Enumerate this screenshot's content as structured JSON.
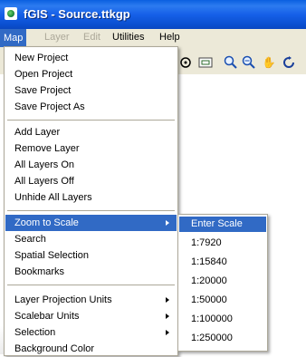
{
  "window": {
    "title": "fGIS - Source.ttkgp"
  },
  "menubar": {
    "items": [
      {
        "label": "Map",
        "state": "active"
      },
      {
        "label": "Layer",
        "state": "disabled"
      },
      {
        "label": "Edit",
        "state": "disabled"
      },
      {
        "label": "Utilities",
        "state": "enabled"
      },
      {
        "label": "Help",
        "state": "enabled"
      }
    ]
  },
  "map_menu": {
    "items": [
      {
        "label": "New Project"
      },
      {
        "label": "Open Project"
      },
      {
        "label": "Save Project"
      },
      {
        "label": "Save Project As"
      },
      {
        "label": "Add Layer"
      },
      {
        "label": "Remove Layer"
      },
      {
        "label": "All Layers On"
      },
      {
        "label": "All Layers Off"
      },
      {
        "label": "Unhide All Layers"
      },
      {
        "label": "Zoom to Scale",
        "submenu": true,
        "highlighted": true
      },
      {
        "label": "Search"
      },
      {
        "label": "Spatial Selection"
      },
      {
        "label": "Bookmarks"
      },
      {
        "label": "Layer Projection Units",
        "submenu": true
      },
      {
        "label": "Scalebar Units",
        "submenu": true
      },
      {
        "label": "Selection",
        "submenu": true
      },
      {
        "label": "Background Color"
      }
    ]
  },
  "scale_submenu": {
    "items": [
      {
        "label": "Enter Scale",
        "highlighted": true
      },
      {
        "label": "1:7920"
      },
      {
        "label": "1:15840"
      },
      {
        "label": "1:20000"
      },
      {
        "label": "1:50000"
      },
      {
        "label": "1:100000"
      },
      {
        "label": "1:250000"
      }
    ]
  },
  "colors": {
    "titlebar": "#0a5fe0",
    "highlight": "#316ac5",
    "menubar": "#ece9d8",
    "disabled": "#aca899"
  }
}
